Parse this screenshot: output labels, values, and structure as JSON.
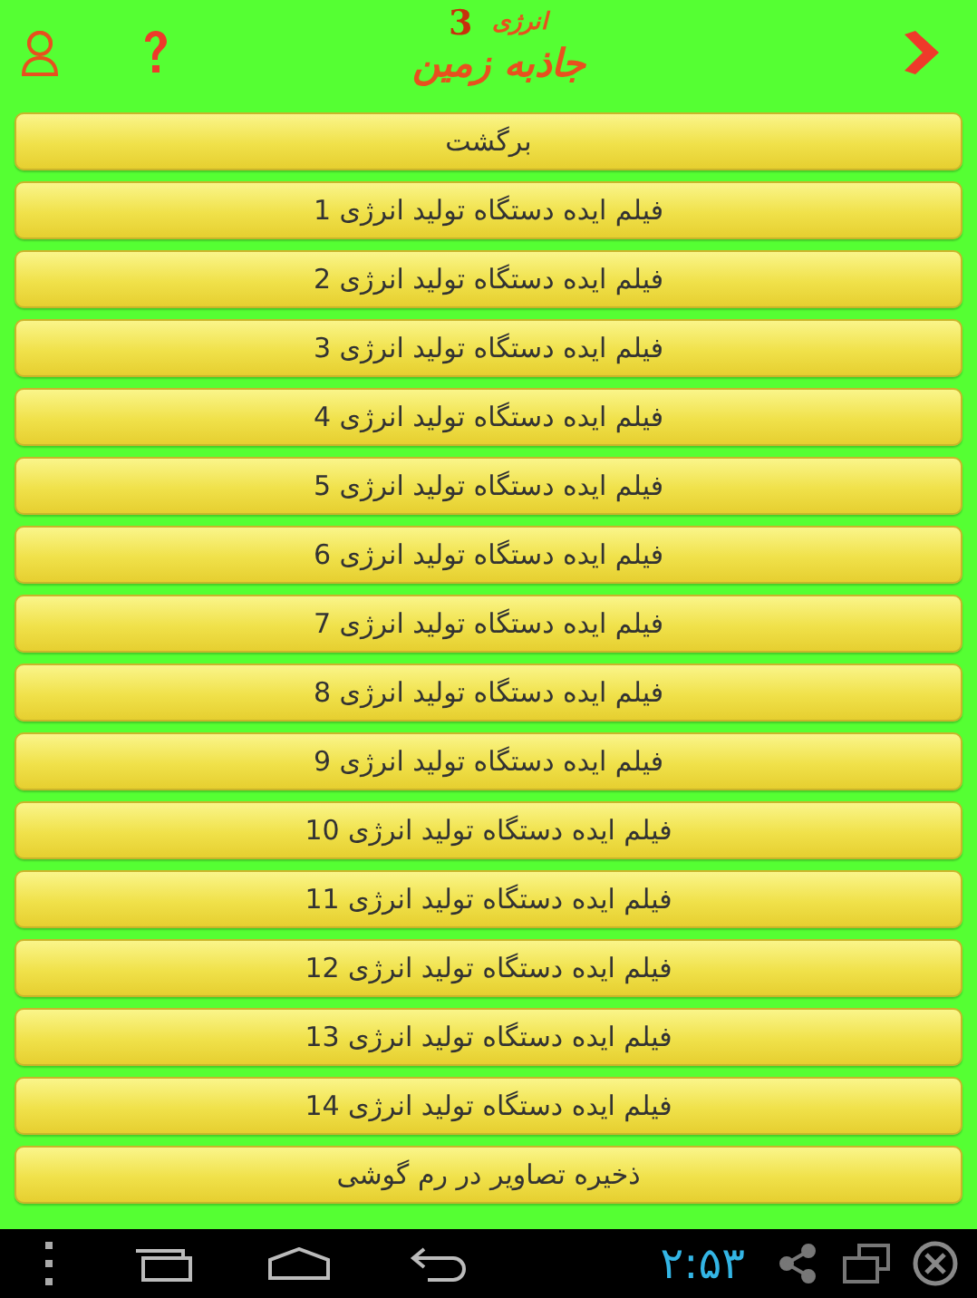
{
  "header": {
    "logo_top": "انرژی",
    "logo_number": "3",
    "logo_main": "جاذبه زمین"
  },
  "menu": [
    "برگشت",
    "فیلم ایده دستگاه تولید انرژی 1",
    "فیلم ایده دستگاه تولید انرژی 2",
    "فیلم ایده دستگاه تولید انرژی 3",
    "فیلم ایده دستگاه تولید انرژی 4",
    "فیلم ایده دستگاه تولید انرژی 5",
    "فیلم ایده دستگاه تولید انرژی 6",
    "فیلم ایده دستگاه تولید انرژی 7",
    "فیلم ایده دستگاه تولید انرژی 8",
    "فیلم ایده دستگاه تولید انرژی 9",
    "فیلم ایده دستگاه تولید انرژی 10",
    "فیلم ایده دستگاه تولید انرژی 11",
    "فیلم ایده دستگاه تولید انرژی 12",
    "فیلم ایده دستگاه تولید انرژی 13",
    "فیلم ایده دستگاه تولید انرژی 14",
    "ذخیره تصاویر در رم گوشی"
  ],
  "status_bar": {
    "time": "۲:۵۳"
  }
}
